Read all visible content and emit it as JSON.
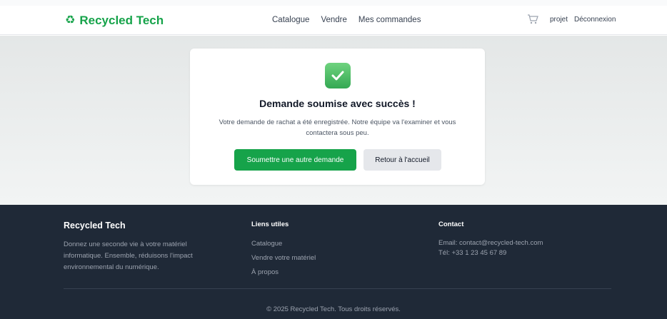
{
  "header": {
    "brand": "Recycled Tech",
    "nav": [
      "Catalogue",
      "Vendre",
      "Mes commandes"
    ],
    "user": "projet",
    "logout": "Déconnexion",
    "cart_icon": "cart-icon",
    "logo_icon": "recycle-icon"
  },
  "card": {
    "icon": "check-icon",
    "title": "Demande soumise avec succès !",
    "text_line1": "Votre demande de rachat a été enregistrée. Notre équipe va l'examiner et vous",
    "text_line2": "contactera sous peu.",
    "primary_button": "Soumettre une autre demande",
    "secondary_button": "Retour à l'accueil"
  },
  "footer": {
    "brand": "Recycled Tech",
    "description": "Donnez une seconde vie à votre matériel informatique. Ensemble, réduisons l'impact environnemental du numérique.",
    "links_title": "Liens utiles",
    "links": [
      "Catalogue",
      "Vendre votre matériel",
      "À propos"
    ],
    "contact_title": "Contact",
    "email": "Email: contact@recycled-tech.com",
    "phone": "Tél: +33 1 23 45 67 89",
    "copyright": "© 2025 Recycled Tech. Tous droits réservés."
  },
  "colors": {
    "brand_green": "#16a34a",
    "footer_bg": "#1f2937"
  }
}
